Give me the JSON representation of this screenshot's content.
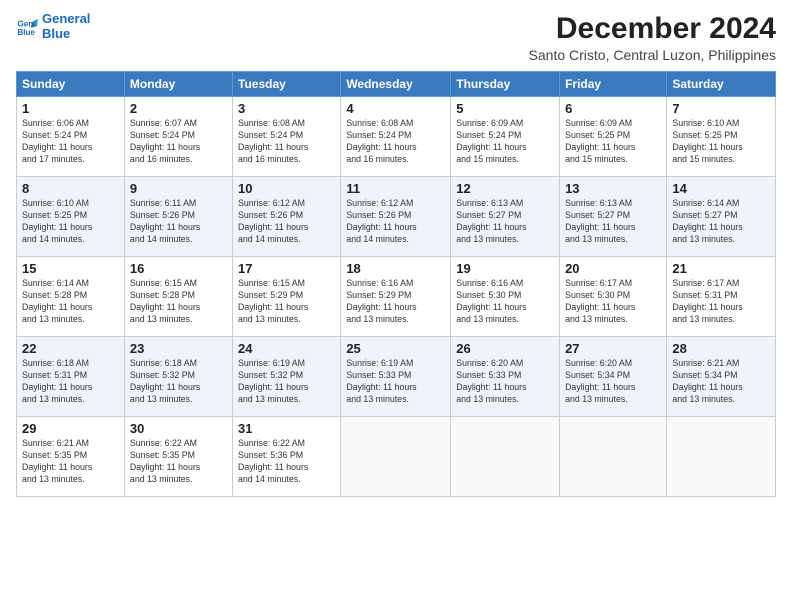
{
  "logo": {
    "line1": "General",
    "line2": "Blue"
  },
  "title": "December 2024",
  "subtitle": "Santo Cristo, Central Luzon, Philippines",
  "headers": [
    "Sunday",
    "Monday",
    "Tuesday",
    "Wednesday",
    "Thursday",
    "Friday",
    "Saturday"
  ],
  "weeks": [
    [
      {
        "day": "1",
        "info": "Sunrise: 6:06 AM\nSunset: 5:24 PM\nDaylight: 11 hours\nand 17 minutes."
      },
      {
        "day": "2",
        "info": "Sunrise: 6:07 AM\nSunset: 5:24 PM\nDaylight: 11 hours\nand 16 minutes."
      },
      {
        "day": "3",
        "info": "Sunrise: 6:08 AM\nSunset: 5:24 PM\nDaylight: 11 hours\nand 16 minutes."
      },
      {
        "day": "4",
        "info": "Sunrise: 6:08 AM\nSunset: 5:24 PM\nDaylight: 11 hours\nand 16 minutes."
      },
      {
        "day": "5",
        "info": "Sunrise: 6:09 AM\nSunset: 5:24 PM\nDaylight: 11 hours\nand 15 minutes."
      },
      {
        "day": "6",
        "info": "Sunrise: 6:09 AM\nSunset: 5:25 PM\nDaylight: 11 hours\nand 15 minutes."
      },
      {
        "day": "7",
        "info": "Sunrise: 6:10 AM\nSunset: 5:25 PM\nDaylight: 11 hours\nand 15 minutes."
      }
    ],
    [
      {
        "day": "8",
        "info": "Sunrise: 6:10 AM\nSunset: 5:25 PM\nDaylight: 11 hours\nand 14 minutes."
      },
      {
        "day": "9",
        "info": "Sunrise: 6:11 AM\nSunset: 5:26 PM\nDaylight: 11 hours\nand 14 minutes."
      },
      {
        "day": "10",
        "info": "Sunrise: 6:12 AM\nSunset: 5:26 PM\nDaylight: 11 hours\nand 14 minutes."
      },
      {
        "day": "11",
        "info": "Sunrise: 6:12 AM\nSunset: 5:26 PM\nDaylight: 11 hours\nand 14 minutes."
      },
      {
        "day": "12",
        "info": "Sunrise: 6:13 AM\nSunset: 5:27 PM\nDaylight: 11 hours\nand 13 minutes."
      },
      {
        "day": "13",
        "info": "Sunrise: 6:13 AM\nSunset: 5:27 PM\nDaylight: 11 hours\nand 13 minutes."
      },
      {
        "day": "14",
        "info": "Sunrise: 6:14 AM\nSunset: 5:27 PM\nDaylight: 11 hours\nand 13 minutes."
      }
    ],
    [
      {
        "day": "15",
        "info": "Sunrise: 6:14 AM\nSunset: 5:28 PM\nDaylight: 11 hours\nand 13 minutes."
      },
      {
        "day": "16",
        "info": "Sunrise: 6:15 AM\nSunset: 5:28 PM\nDaylight: 11 hours\nand 13 minutes."
      },
      {
        "day": "17",
        "info": "Sunrise: 6:15 AM\nSunset: 5:29 PM\nDaylight: 11 hours\nand 13 minutes."
      },
      {
        "day": "18",
        "info": "Sunrise: 6:16 AM\nSunset: 5:29 PM\nDaylight: 11 hours\nand 13 minutes."
      },
      {
        "day": "19",
        "info": "Sunrise: 6:16 AM\nSunset: 5:30 PM\nDaylight: 11 hours\nand 13 minutes."
      },
      {
        "day": "20",
        "info": "Sunrise: 6:17 AM\nSunset: 5:30 PM\nDaylight: 11 hours\nand 13 minutes."
      },
      {
        "day": "21",
        "info": "Sunrise: 6:17 AM\nSunset: 5:31 PM\nDaylight: 11 hours\nand 13 minutes."
      }
    ],
    [
      {
        "day": "22",
        "info": "Sunrise: 6:18 AM\nSunset: 5:31 PM\nDaylight: 11 hours\nand 13 minutes."
      },
      {
        "day": "23",
        "info": "Sunrise: 6:18 AM\nSunset: 5:32 PM\nDaylight: 11 hours\nand 13 minutes."
      },
      {
        "day": "24",
        "info": "Sunrise: 6:19 AM\nSunset: 5:32 PM\nDaylight: 11 hours\nand 13 minutes."
      },
      {
        "day": "25",
        "info": "Sunrise: 6:19 AM\nSunset: 5:33 PM\nDaylight: 11 hours\nand 13 minutes."
      },
      {
        "day": "26",
        "info": "Sunrise: 6:20 AM\nSunset: 5:33 PM\nDaylight: 11 hours\nand 13 minutes."
      },
      {
        "day": "27",
        "info": "Sunrise: 6:20 AM\nSunset: 5:34 PM\nDaylight: 11 hours\nand 13 minutes."
      },
      {
        "day": "28",
        "info": "Sunrise: 6:21 AM\nSunset: 5:34 PM\nDaylight: 11 hours\nand 13 minutes."
      }
    ],
    [
      {
        "day": "29",
        "info": "Sunrise: 6:21 AM\nSunset: 5:35 PM\nDaylight: 11 hours\nand 13 minutes."
      },
      {
        "day": "30",
        "info": "Sunrise: 6:22 AM\nSunset: 5:35 PM\nDaylight: 11 hours\nand 13 minutes."
      },
      {
        "day": "31",
        "info": "Sunrise: 6:22 AM\nSunset: 5:36 PM\nDaylight: 11 hours\nand 14 minutes."
      },
      {
        "day": "",
        "info": ""
      },
      {
        "day": "",
        "info": ""
      },
      {
        "day": "",
        "info": ""
      },
      {
        "day": "",
        "info": ""
      }
    ]
  ]
}
